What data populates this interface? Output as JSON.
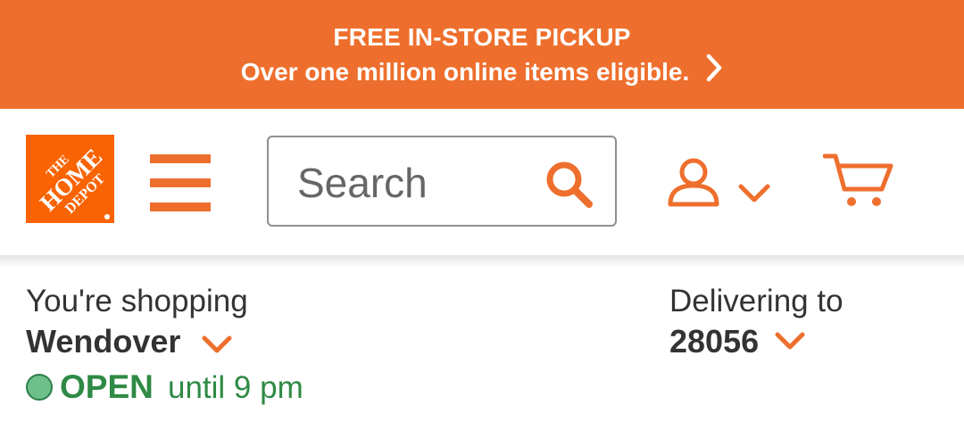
{
  "colors": {
    "brand_orange": "#ee6f2d",
    "logo_orange": "#f96302",
    "open_green": "#2f8a45",
    "text": "#333333"
  },
  "promo": {
    "title": "FREE IN-STORE PICKUP",
    "subtitle": "Over one million online items eligible.",
    "chevron_icon": "chevron-right-icon"
  },
  "header": {
    "logo_text": [
      "THE",
      "HOME",
      "DEPOT"
    ],
    "menu_icon": "hamburger-menu-icon",
    "search": {
      "placeholder": "Search",
      "value": ""
    },
    "account_icon": "user-icon",
    "cart_icon": "cart-icon"
  },
  "store": {
    "label": "You're shopping",
    "name": "Wendover",
    "status": "OPEN",
    "hours": "until 9 pm"
  },
  "delivery": {
    "label": "Delivering to",
    "zip": "28056"
  }
}
